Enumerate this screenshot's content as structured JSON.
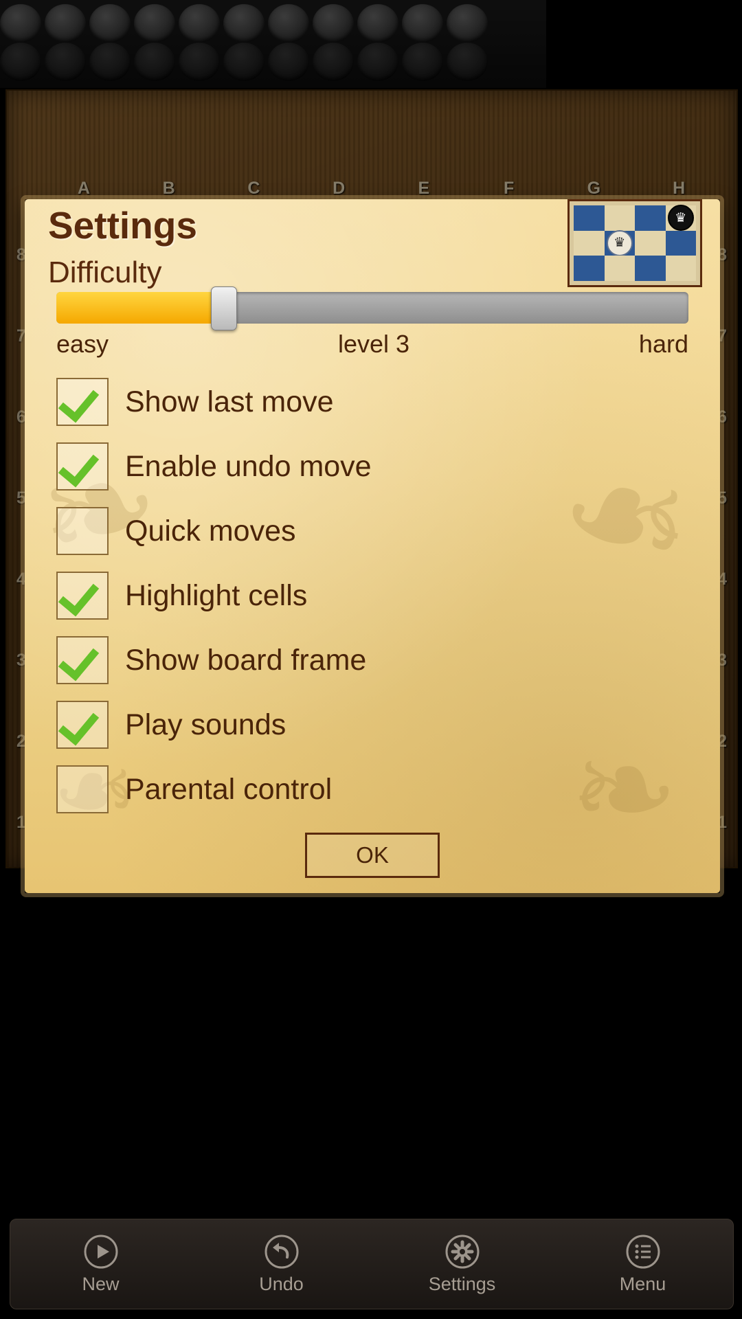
{
  "board": {
    "file_labels": [
      "A",
      "B",
      "C",
      "D",
      "E",
      "F",
      "G",
      "H"
    ],
    "rank_labels": [
      "8",
      "7",
      "6",
      "5",
      "4",
      "3",
      "2",
      "1"
    ],
    "top_row_pieces": 4,
    "captured_tray_rows": 2,
    "captured_per_row": 11
  },
  "dialog": {
    "title": "Settings",
    "difficulty_label": "Difficulty",
    "slider": {
      "min_label": "easy",
      "value_label": "level 3",
      "max_label": "hard",
      "value": 3,
      "min": 1,
      "max": 10,
      "fill_percent": 26.5,
      "fill_color": "#f5a800",
      "track_color": "#9a9a9a"
    },
    "options": [
      {
        "label": "Show last move",
        "checked": true
      },
      {
        "label": "Enable undo move",
        "checked": true
      },
      {
        "label": "Quick moves",
        "checked": false
      },
      {
        "label": "Highlight cells",
        "checked": true
      },
      {
        "label": "Show board frame",
        "checked": true
      },
      {
        "label": "Play sounds",
        "checked": true
      },
      {
        "label": "Parental control",
        "checked": false
      }
    ],
    "ok_label": "OK",
    "preview": {
      "black_piece_glyph": "♛",
      "white_piece_glyph": "♛"
    },
    "accent_color": "#5a2a0d",
    "paper_color": "#f3d893",
    "check_color": "#66c12a"
  },
  "toolbar": {
    "items": [
      {
        "label": "New",
        "icon": "play-icon"
      },
      {
        "label": "Undo",
        "icon": "undo-icon"
      },
      {
        "label": "Settings",
        "icon": "gear-icon"
      },
      {
        "label": "Menu",
        "icon": "list-icon"
      }
    ]
  }
}
